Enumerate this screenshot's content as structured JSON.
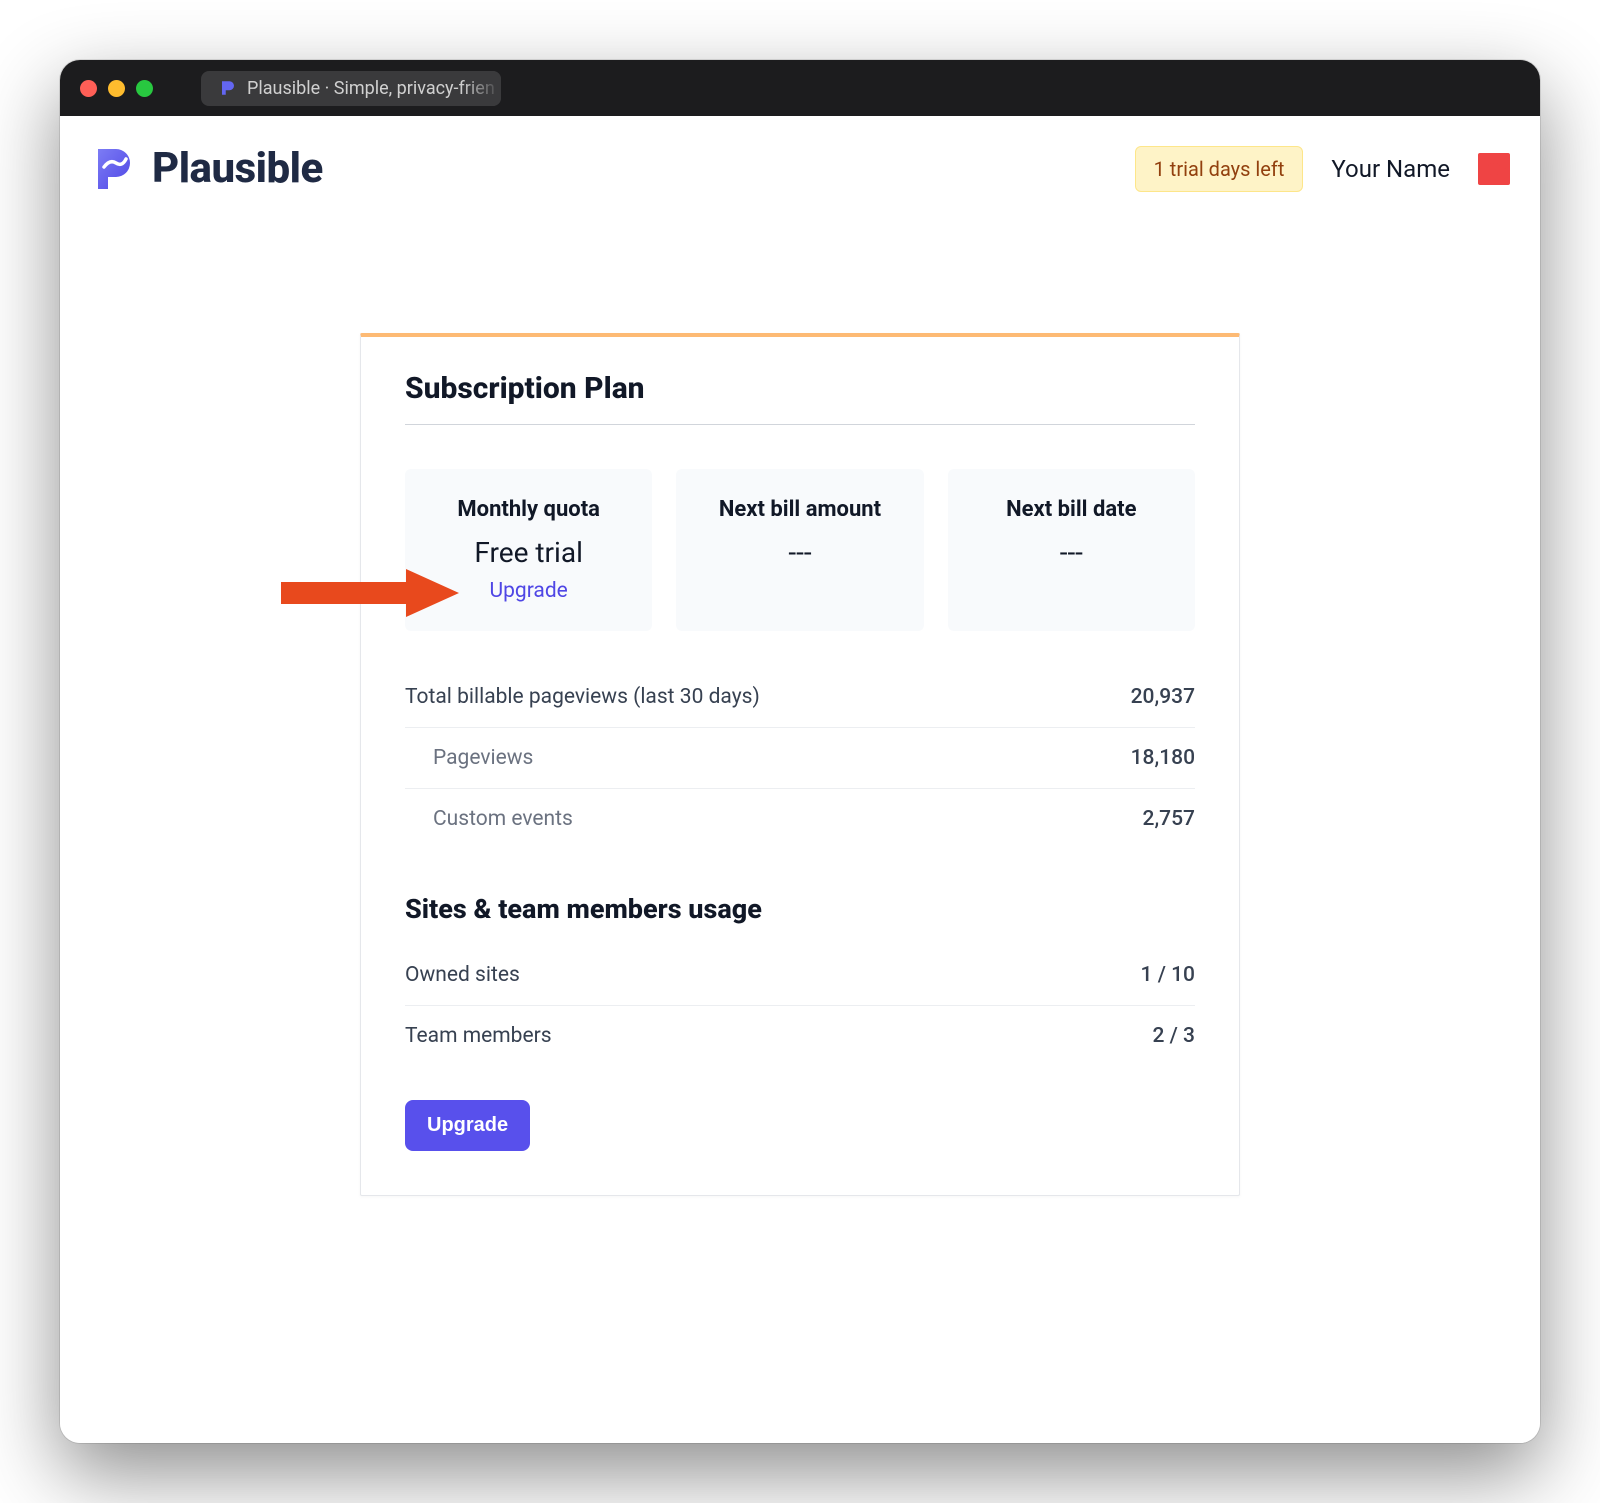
{
  "browser": {
    "tab_title": "Plausible · Simple, privacy-frien"
  },
  "header": {
    "brand_name": "Plausible",
    "trial_badge": "1 trial days left",
    "user_name": "Your Name"
  },
  "subscription": {
    "title": "Subscription Plan",
    "tiles": {
      "monthly_quota": {
        "label": "Monthly quota",
        "value": "Free trial",
        "link": "Upgrade"
      },
      "next_bill_amount": {
        "label": "Next bill amount",
        "value": "---"
      },
      "next_bill_date": {
        "label": "Next bill date",
        "value": "---"
      }
    },
    "billable": {
      "total_label": "Total billable pageviews (last 30 days)",
      "total_value": "20,937",
      "pageviews_label": "Pageviews",
      "pageviews_value": "18,180",
      "custom_events_label": "Custom events",
      "custom_events_value": "2,757"
    },
    "usage": {
      "title": "Sites & team members usage",
      "owned_sites_label": "Owned sites",
      "owned_sites_value": "1 / 10",
      "team_members_label": "Team members",
      "team_members_value": "2 / 3"
    },
    "upgrade_button": "Upgrade"
  }
}
